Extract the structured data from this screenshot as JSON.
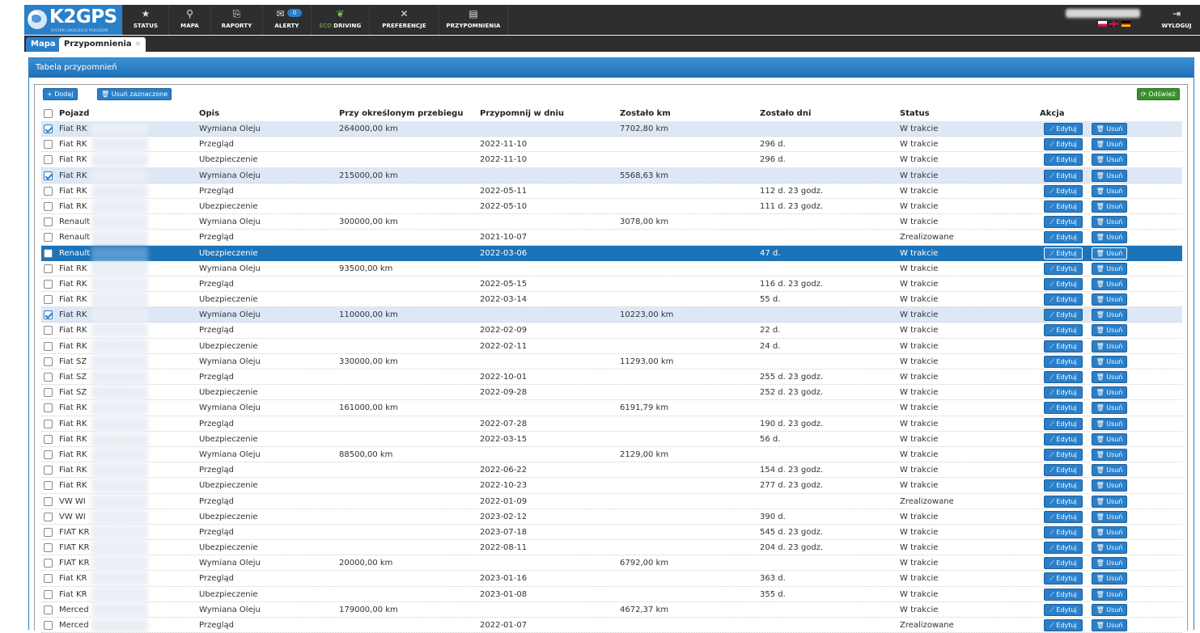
{
  "brand": {
    "name": "K2GPS",
    "tagline": "SYSTEM LOKALIZACJI POJAZDÓW"
  },
  "nav": [
    {
      "label": "STATUS",
      "icon": "★"
    },
    {
      "label": "MAPA",
      "icon": "⚲"
    },
    {
      "label": "RAPORTY",
      "icon": "⎘"
    },
    {
      "label": "ALERTY",
      "icon": "✉",
      "badge": "0"
    },
    {
      "label_a": "ECO",
      "label_b": "DRIVING",
      "icon": "❦"
    },
    {
      "label": "PREFERENCJE",
      "icon": "✕"
    },
    {
      "label": "PRZYPOMNIENIA",
      "icon": "▤"
    }
  ],
  "logout": {
    "label": "WYLOGUJ",
    "icon": "⇥"
  },
  "tabs": {
    "map": "Mapa",
    "reminders": "Przypomnienia",
    "close": "×"
  },
  "panel": {
    "title": "Tabela przypomnień"
  },
  "toolbar": {
    "add": "+ Dodaj",
    "delete_selected": "🗑 Usuń zaznaczone",
    "refresh": "⟳ Odśwież"
  },
  "columns": {
    "vehicle": "Pojazd",
    "description": "Opis",
    "at_mileage": "Przy określonym przebiegu",
    "remind_on": "Przypomnij w dniu",
    "km_left": "Zostało km",
    "days_left": "Zostało dni",
    "status": "Status",
    "action": "Akcja"
  },
  "actions": {
    "edit": "⟋ Edytuj",
    "delete": "🗑 Usuń"
  },
  "rows": [
    {
      "vehicle": "Fiat RK",
      "desc": "Wymiana Oleju",
      "mileage": "264000,00 km",
      "date": "",
      "km": "7702,80 km",
      "days": "",
      "status": "W trakcie",
      "checked": true
    },
    {
      "vehicle": "Fiat RK",
      "desc": "Przegląd",
      "mileage": "",
      "date": "2022-11-10",
      "km": "",
      "days": "296 d.",
      "status": "W trakcie"
    },
    {
      "vehicle": "Fiat RK",
      "desc": "Ubezpieczenie",
      "mileage": "",
      "date": "2022-11-10",
      "km": "",
      "days": "296 d.",
      "status": "W trakcie"
    },
    {
      "vehicle": "Fiat RK",
      "desc": "Wymiana Oleju",
      "mileage": "215000,00 km",
      "date": "",
      "km": "5568,63 km",
      "days": "",
      "status": "W trakcie",
      "checked": true
    },
    {
      "vehicle": "Fiat RK",
      "desc": "Przegląd",
      "mileage": "",
      "date": "2022-05-11",
      "km": "",
      "days": "112 d. 23 godz.",
      "status": "W trakcie"
    },
    {
      "vehicle": "Fiat RK",
      "desc": "Ubezpieczenie",
      "mileage": "",
      "date": "2022-05-10",
      "km": "",
      "days": "111 d. 23 godz.",
      "status": "W trakcie"
    },
    {
      "vehicle": "Renault",
      "desc": "Wymiana Oleju",
      "mileage": "300000,00 km",
      "date": "",
      "km": "3078,00 km",
      "days": "",
      "status": "W trakcie"
    },
    {
      "vehicle": "Renault",
      "desc": "Przegląd",
      "mileage": "",
      "date": "2021-10-07",
      "km": "",
      "days": "",
      "status": "Zrealizowane"
    },
    {
      "vehicle": "Renault",
      "desc": "Ubezpieczenie",
      "mileage": "",
      "date": "2022-03-06",
      "km": "",
      "days": "47 d.",
      "status": "W trakcie",
      "selected": true
    },
    {
      "vehicle": "Fiat RK",
      "desc": "Wymiana Oleju",
      "mileage": "93500,00 km",
      "date": "",
      "km": "",
      "days": "",
      "status": "W trakcie"
    },
    {
      "vehicle": "Fiat RK",
      "desc": "Przegląd",
      "mileage": "",
      "date": "2022-05-15",
      "km": "",
      "days": "116 d. 23 godz.",
      "status": "W trakcie"
    },
    {
      "vehicle": "Fiat RK",
      "desc": "Ubezpieczenie",
      "mileage": "",
      "date": "2022-03-14",
      "km": "",
      "days": "55 d.",
      "status": "W trakcie"
    },
    {
      "vehicle": "Fiat RK",
      "desc": "Wymiana Oleju",
      "mileage": "110000,00 km",
      "date": "",
      "km": "10223,00 km",
      "days": "",
      "status": "W trakcie",
      "checked": true
    },
    {
      "vehicle": "Fiat RK",
      "desc": "Przegląd",
      "mileage": "",
      "date": "2022-02-09",
      "km": "",
      "days": "22 d.",
      "status": "W trakcie"
    },
    {
      "vehicle": "Fiat RK",
      "desc": "Ubezpieczenie",
      "mileage": "",
      "date": "2022-02-11",
      "km": "",
      "days": "24 d.",
      "status": "W trakcie"
    },
    {
      "vehicle": "Fiat SZ",
      "desc": "Wymiana Oleju",
      "mileage": "330000,00 km",
      "date": "",
      "km": "11293,00 km",
      "days": "",
      "status": "W trakcie"
    },
    {
      "vehicle": "Fiat SZ",
      "desc": "Przegląd",
      "mileage": "",
      "date": "2022-10-01",
      "km": "",
      "days": "255 d. 23 godz.",
      "status": "W trakcie"
    },
    {
      "vehicle": "Fiat SZ",
      "desc": "Ubezpieczenie",
      "mileage": "",
      "date": "2022-09-28",
      "km": "",
      "days": "252 d. 23 godz.",
      "status": "W trakcie"
    },
    {
      "vehicle": "Fiat RK",
      "desc": "Wymiana Oleju",
      "mileage": "161000,00 km",
      "date": "",
      "km": "6191,79 km",
      "days": "",
      "status": "W trakcie"
    },
    {
      "vehicle": "Fiat RK",
      "desc": "Przegląd",
      "mileage": "",
      "date": "2022-07-28",
      "km": "",
      "days": "190 d. 23 godz.",
      "status": "W trakcie"
    },
    {
      "vehicle": "Fiat RK",
      "desc": "Ubezpieczenie",
      "mileage": "",
      "date": "2022-03-15",
      "km": "",
      "days": "56 d.",
      "status": "W trakcie"
    },
    {
      "vehicle": "Fiat RK",
      "desc": "Wymiana Oleju",
      "mileage": "88500,00 km",
      "date": "",
      "km": "2129,00 km",
      "days": "",
      "status": "W trakcie"
    },
    {
      "vehicle": "Fiat RK",
      "desc": "Przegląd",
      "mileage": "",
      "date": "2022-06-22",
      "km": "",
      "days": "154 d. 23 godz.",
      "status": "W trakcie"
    },
    {
      "vehicle": "Fiat RK",
      "desc": "Ubezpieczenie",
      "mileage": "",
      "date": "2022-10-23",
      "km": "",
      "days": "277 d. 23 godz.",
      "status": "W trakcie"
    },
    {
      "vehicle": "VW WI",
      "desc": "Przegląd",
      "mileage": "",
      "date": "2022-01-09",
      "km": "",
      "days": "",
      "status": "Zrealizowane"
    },
    {
      "vehicle": "VW WI",
      "desc": "Ubezpieczenie",
      "mileage": "",
      "date": "2023-02-12",
      "km": "",
      "days": "390 d.",
      "status": "W trakcie"
    },
    {
      "vehicle": "FIAT KR",
      "desc": "Przegląd",
      "mileage": "",
      "date": "2023-07-18",
      "km": "",
      "days": "545 d. 23 godz.",
      "status": "W trakcie"
    },
    {
      "vehicle": "FIAT KR",
      "desc": "Ubezpieczenie",
      "mileage": "",
      "date": "2022-08-11",
      "km": "",
      "days": "204 d. 23 godz.",
      "status": "W trakcie"
    },
    {
      "vehicle": "FIAT KR",
      "desc": "Wymiana Oleju",
      "mileage": "20000,00 km",
      "date": "",
      "km": "6792,00 km",
      "days": "",
      "status": "W trakcie"
    },
    {
      "vehicle": "Fiat KR",
      "desc": "Przegląd",
      "mileage": "",
      "date": "2023-01-16",
      "km": "",
      "days": "363 d.",
      "status": "W trakcie"
    },
    {
      "vehicle": "Fiat KR",
      "desc": "Ubezpieczenie",
      "mileage": "",
      "date": "2023-01-08",
      "km": "",
      "days": "355 d.",
      "status": "W trakcie"
    },
    {
      "vehicle": "Merced",
      "desc": "Wymiana Oleju",
      "mileage": "179000,00 km",
      "date": "",
      "km": "4672,37 km",
      "days": "",
      "status": "W trakcie"
    },
    {
      "vehicle": "Merced",
      "desc": "Przegląd",
      "mileage": "",
      "date": "2022-01-07",
      "km": "",
      "days": "",
      "status": "Zrealizowane"
    }
  ]
}
